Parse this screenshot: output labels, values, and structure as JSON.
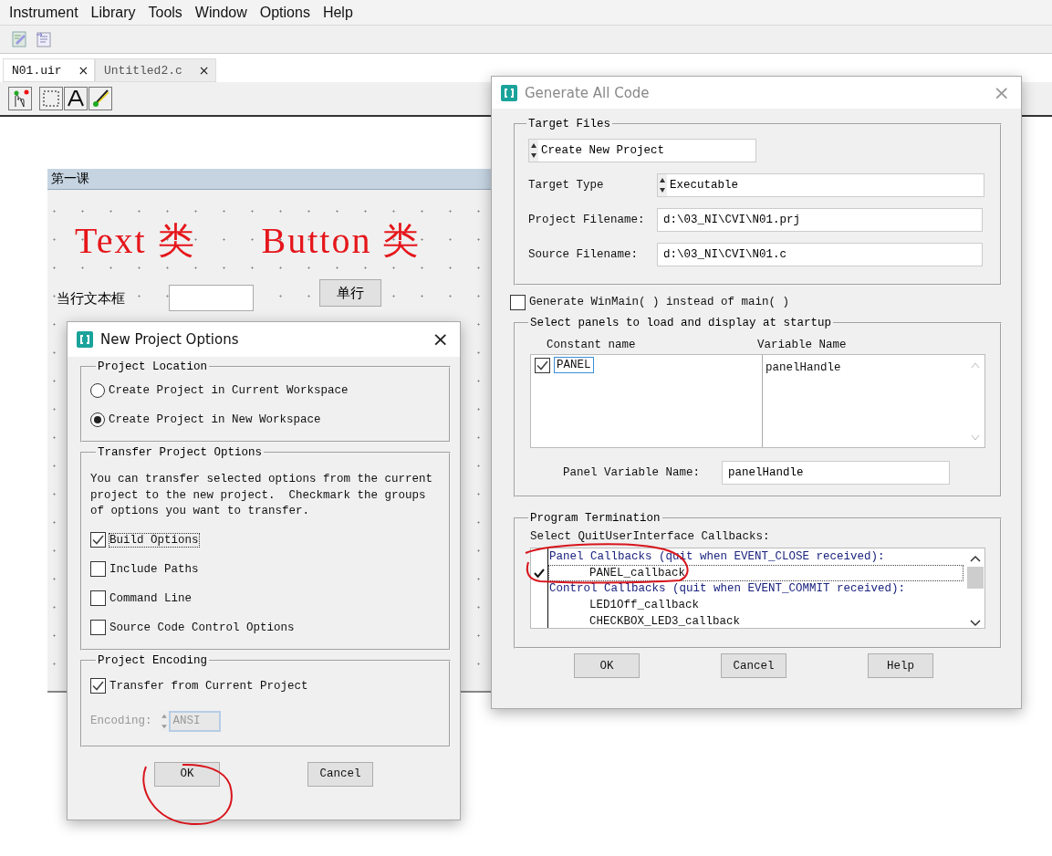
{
  "menu": [
    "Instrument",
    "Library",
    "Tools",
    "Window",
    "Options",
    "Help"
  ],
  "tabs": [
    {
      "label": "N01.uir",
      "close": "×",
      "selected": true
    },
    {
      "label": "Untitled2.c",
      "close": "×",
      "selected": false
    }
  ],
  "panel": {
    "title": "第一课",
    "headings": [
      "Text 类",
      "Button 类"
    ],
    "field_label": "当行文本框",
    "button": "单行"
  },
  "new_project_dialog": {
    "title": "New Project Options",
    "close": "×",
    "location": {
      "title": "Project Location",
      "options": [
        {
          "label": "Create Project in Current Workspace",
          "selected": false
        },
        {
          "label": "Create Project in New Workspace",
          "selected": true
        }
      ]
    },
    "transfer": {
      "title": "Transfer Project Options",
      "description": "You can transfer selected options from the current project to the new project.  Checkmark the groups of options you want to transfer.",
      "options": [
        {
          "label": "Build Options",
          "checked": true,
          "focused": true
        },
        {
          "label": "Include Paths",
          "checked": false,
          "focused": false
        },
        {
          "label": "Command Line",
          "checked": false,
          "focused": false
        },
        {
          "label": "Source Code Control Options",
          "checked": false,
          "focused": false
        }
      ]
    },
    "encoding": {
      "title": "Project Encoding",
      "transfer_label": "Transfer from Current Project",
      "transfer_checked": true,
      "label": "Encoding:",
      "value": "ANSI",
      "disabled": true
    },
    "buttons": [
      "OK",
      "Cancel"
    ]
  },
  "generate_dialog": {
    "title": "Generate All Code",
    "close": "×",
    "target_files": {
      "title": "Target Files",
      "mode": "Create New Project",
      "fields": [
        {
          "label": "Target Type",
          "value": "Executable",
          "kind": "spinner"
        },
        {
          "label": "Project Filename:",
          "value": "d:\\03_NI\\CVI\\N01.prj",
          "kind": "text"
        },
        {
          "label": "Source Filename:",
          "value": "d:\\03_NI\\CVI\\N01.c",
          "kind": "text"
        }
      ]
    },
    "winmain": {
      "label": "Generate WinMain( ) instead of main( )",
      "checked": false
    },
    "panels": {
      "title": "Select panels to load and display at startup",
      "columns": [
        "Constant name",
        "Variable Name"
      ],
      "rows": [
        {
          "constant": "PANEL",
          "variable": "panelHandle",
          "checked": true,
          "selected": true
        }
      ],
      "variable_label": "Panel Variable Name:",
      "variable_value": "panelHandle"
    },
    "termination": {
      "title": "Program Termination",
      "label": "Select QuitUserInterface Callbacks:",
      "groups": [
        {
          "title": "Panel Callbacks (quit when EVENT_CLOSE received):",
          "callbacks": [
            {
              "name": "PANEL_callback",
              "checked": true,
              "selected": true
            }
          ]
        },
        {
          "title": "Control Callbacks (quit when EVENT_COMMIT received):",
          "callbacks": [
            {
              "name": "LED1Off_callback",
              "checked": false,
              "selected": false
            },
            {
              "name": "CHECKBOX_LED3_callback",
              "checked": false,
              "selected": false
            }
          ]
        }
      ]
    },
    "buttons": [
      "OK",
      "Cancel",
      "Help"
    ]
  }
}
